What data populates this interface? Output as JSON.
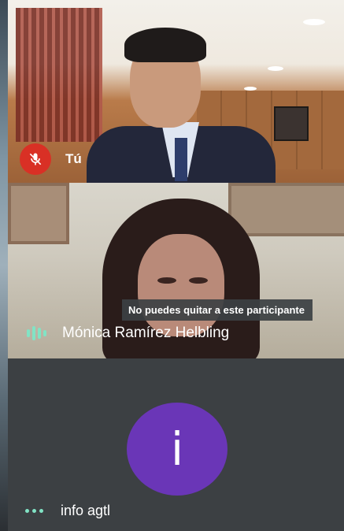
{
  "participants": [
    {
      "name": "Tú",
      "mic": "muted",
      "icon": "mic-off-icon"
    },
    {
      "name": "Mónica Ramírez Helbling",
      "status": "speaking",
      "icon": "audio-level-icon",
      "tooltip": "No puedes quitar a este participante"
    },
    {
      "name": "info agtl",
      "avatar_letter": "i",
      "avatar_color": "#6a36b7",
      "icon": "more-dots-icon"
    }
  ],
  "colors": {
    "muted_red": "#d93025",
    "speaking_teal": "#81e3c5",
    "tile_dark": "#3c4043"
  }
}
